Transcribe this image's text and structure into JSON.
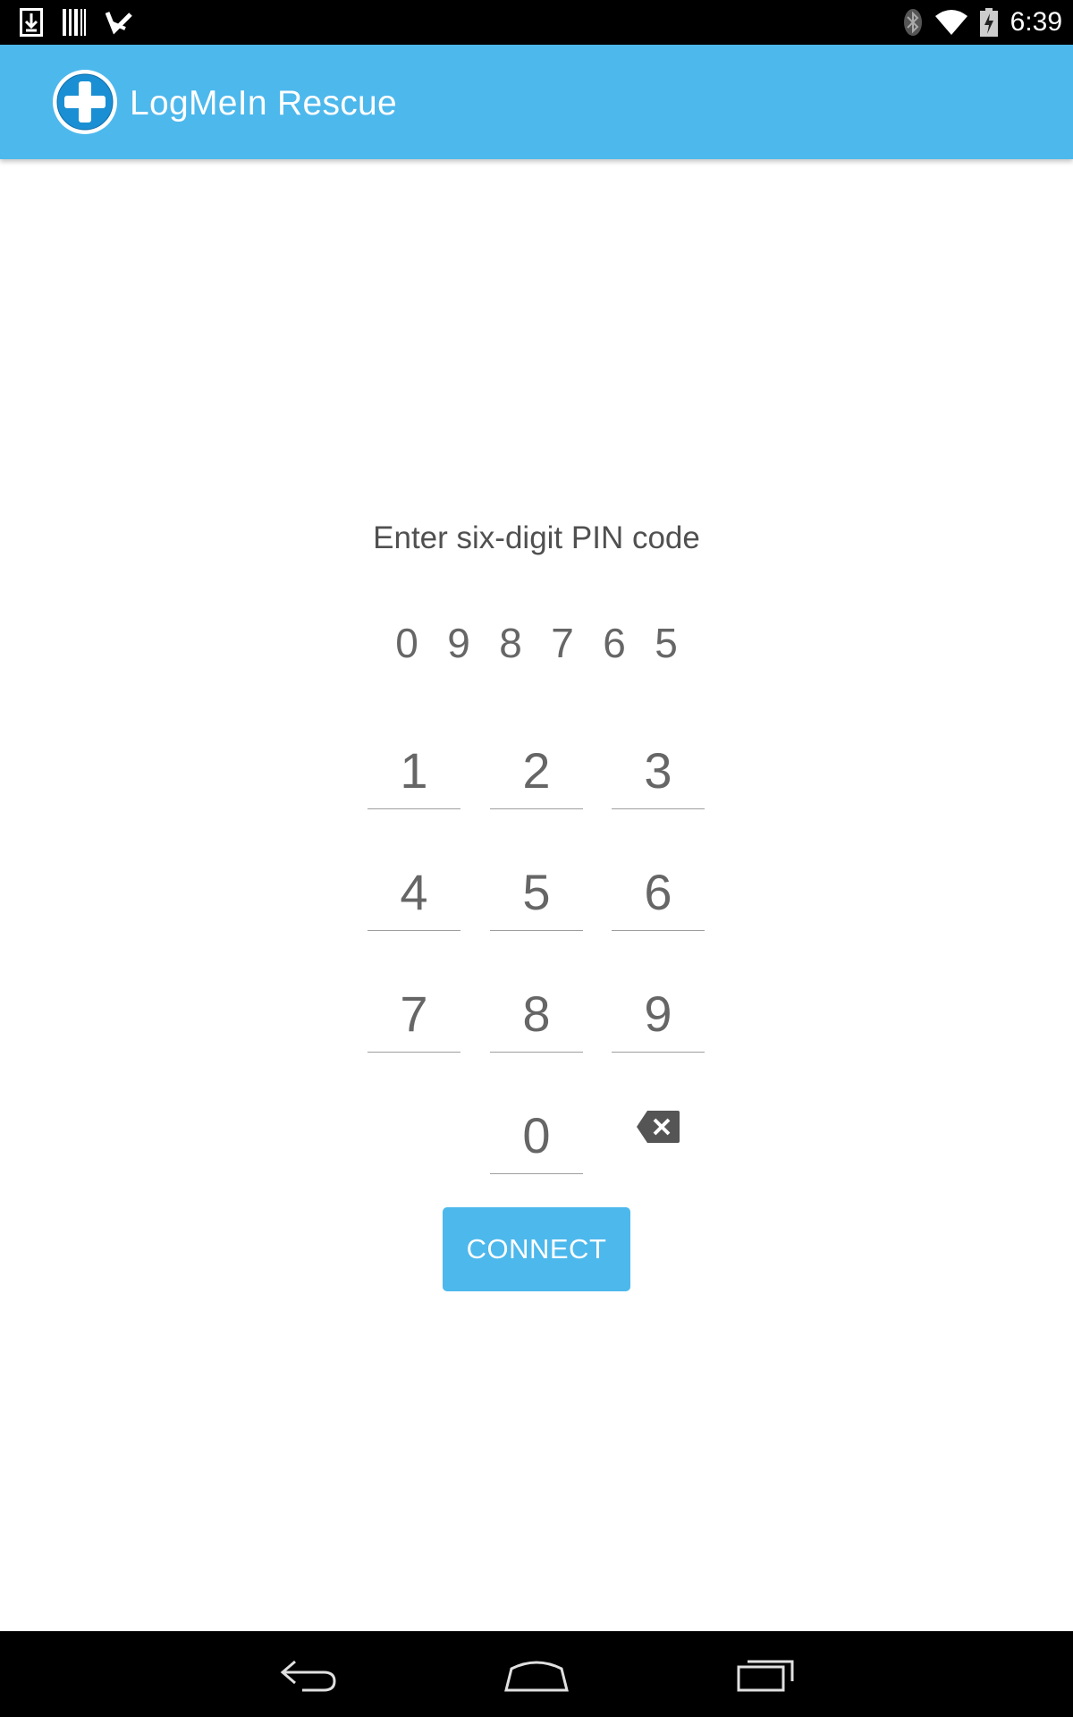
{
  "status_bar": {
    "time": "6:39",
    "left_icons": [
      "download-icon",
      "barcode-icon",
      "checkmark-icon"
    ],
    "right_icons": [
      "bluetooth-icon",
      "wifi-icon",
      "battery-charging-icon"
    ]
  },
  "app_bar": {
    "title": "LogMeIn Rescue",
    "logo_icon": "logmein-rescue-logo",
    "color": "#4db8ec"
  },
  "pin_entry": {
    "prompt": "Enter six-digit PIN code",
    "digits": [
      "0",
      "9",
      "8",
      "7",
      "6",
      "5"
    ]
  },
  "keypad": {
    "keys": [
      "1",
      "2",
      "3",
      "4",
      "5",
      "6",
      "7",
      "8",
      "9",
      "0"
    ],
    "backspace_icon": "backspace-icon"
  },
  "connect_button": {
    "label": "CONNECT"
  },
  "nav_bar": {
    "icons": [
      "back-icon",
      "home-icon",
      "recent-apps-icon"
    ]
  }
}
